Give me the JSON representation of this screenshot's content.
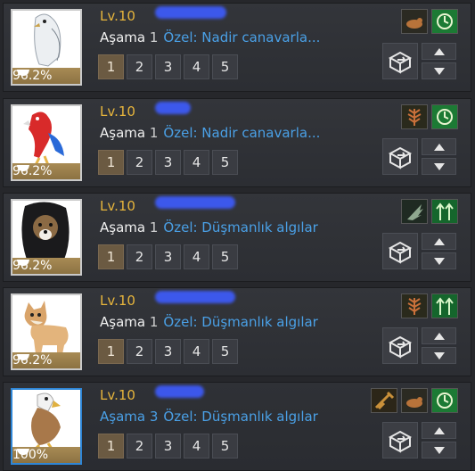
{
  "level_prefix": "Lv.",
  "stage_label": "Aşama",
  "tab_labels": [
    "1",
    "2",
    "3",
    "4",
    "5"
  ],
  "pets": [
    {
      "level": "10",
      "stage": "1",
      "special": "Özel: Nadir canavarla...",
      "hunger": "96.2%",
      "animal": "white falcon",
      "skills": [
        "beast-icon",
        "speed-icon"
      ],
      "selected": false
    },
    {
      "level": "10",
      "stage": "1",
      "special": "Özel: Nadir canavarla...",
      "hunger": "96.2%",
      "animal": "red parrot",
      "skills": [
        "growth-icon",
        "speed-icon"
      ],
      "selected": false
    },
    {
      "level": "10",
      "stage": "1",
      "special": "Özel: Düşmanlık algılar",
      "hunger": "96.2%",
      "animal": "dog in black hood",
      "skills": [
        "wing-icon",
        "arrows-up-icon"
      ],
      "selected": false
    },
    {
      "level": "10",
      "stage": "1",
      "special": "Özel: Düşmanlık algılar",
      "hunger": "96.2%",
      "animal": "shiba dog",
      "skills": [
        "growth-icon",
        "arrows-up-icon"
      ],
      "selected": false
    },
    {
      "level": "10",
      "stage": "3",
      "special": "Özel: Düşmanlık algılar",
      "hunger": "100%",
      "animal": "eagle",
      "skills": [
        "gathering-icon",
        "beast-icon",
        "speed-icon"
      ],
      "selected": true
    }
  ],
  "colors": {
    "level": "#e7b53c",
    "special": "#4aa0e6",
    "selected_border": "#2f86d6",
    "active_tab": "#6b5a42"
  }
}
